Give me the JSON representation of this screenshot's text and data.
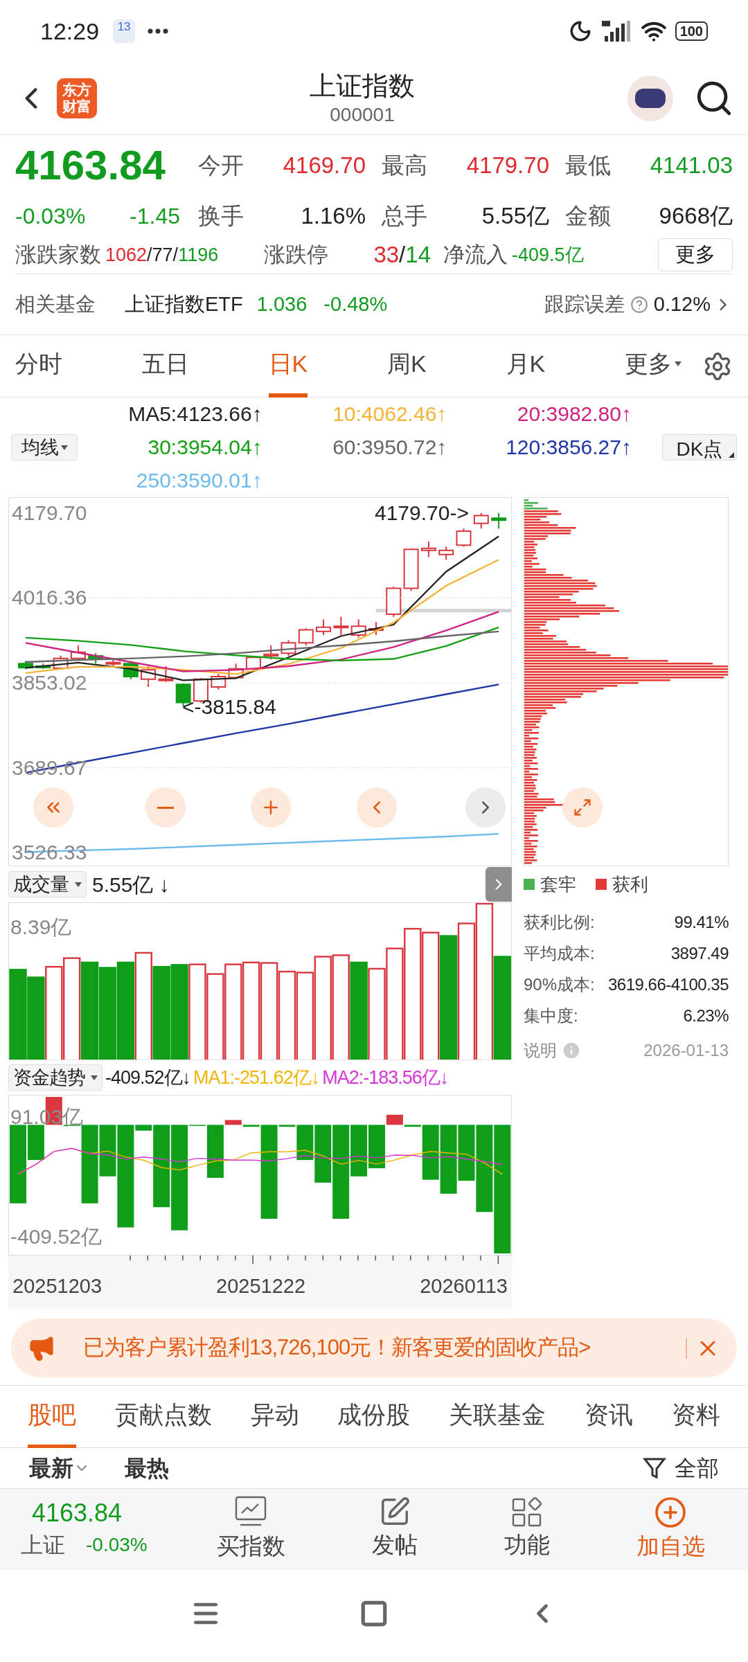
{
  "status_bar": {
    "time": "12:29",
    "date_badge": "13",
    "battery": "100"
  },
  "header": {
    "logo_lines": [
      "东方",
      "财富"
    ],
    "title": "上证指数",
    "code": "000001"
  },
  "quote": {
    "price": "4163.84",
    "change_pct": "-0.03%",
    "change": "-1.45",
    "color": "#119c1f",
    "stats": [
      {
        "label": "今开",
        "value": "4169.70",
        "color": "#e0282e"
      },
      {
        "label": "最高",
        "value": "4179.70",
        "color": "#e0282e"
      },
      {
        "label": "最低",
        "value": "4141.03",
        "color": "#119c1f"
      },
      {
        "label": "换手",
        "value": "1.16%",
        "color": "#222222"
      },
      {
        "label": "总手",
        "value": "5.55亿",
        "color": "#222222"
      },
      {
        "label": "金额",
        "value": "9668亿",
        "color": "#222222"
      }
    ],
    "breadth": [
      {
        "label": "涨跌家数",
        "parts": [
          {
            "text": "1062",
            "color": "#e0282e"
          },
          {
            "text": "/77/",
            "color": "#222222"
          },
          {
            "text": "1196",
            "color": "#119c1f"
          }
        ]
      },
      {
        "label": "涨跌停",
        "parts": [
          {
            "text": "33",
            "color": "#e0282e"
          },
          {
            "text": "/",
            "color": "#222222"
          },
          {
            "text": "14",
            "color": "#119c1f"
          }
        ]
      },
      {
        "label": "净流入",
        "parts": [
          {
            "text": "-409.5亿",
            "color": "#119c1f"
          }
        ]
      }
    ],
    "more_button": "更多"
  },
  "fund": {
    "label": "相关基金",
    "name": "上证指数ETF",
    "price": "1.036",
    "change": "-0.48%",
    "color": "#119c1f",
    "error_label": "跟踪误差",
    "error_value": "0.12%"
  },
  "tabs": [
    {
      "label": "分时",
      "selected": false,
      "dropdown": false
    },
    {
      "label": "五日",
      "selected": false,
      "dropdown": false
    },
    {
      "label": "日K",
      "selected": true,
      "dropdown": false
    },
    {
      "label": "周K",
      "selected": false,
      "dropdown": false
    },
    {
      "label": "月K",
      "selected": false,
      "dropdown": false
    },
    {
      "label": "更多",
      "selected": false,
      "dropdown": true
    }
  ],
  "ma_legend": {
    "selector": "均线",
    "dk_button": "DK点",
    "items": [
      {
        "text": "MA5:4123.66↑",
        "color": "#222222"
      },
      {
        "text": "10:4062.46↑",
        "color": "#f5b335"
      },
      {
        "text": "20:3982.80↑",
        "color": "#d0237f"
      },
      {
        "text": "30:3954.04↑",
        "color": "#14a014"
      },
      {
        "text": "60:3950.72↑",
        "color": "#666666"
      },
      {
        "text": "120:3856.27↑",
        "color": "#1f35a8"
      },
      {
        "text": "250:3590.01↑",
        "color": "#6bbbef"
      }
    ]
  },
  "chart": {
    "high_marker": "4179.70->",
    "low_marker": "<-3815.84",
    "chart_data": {
      "type": "line",
      "grid": true,
      "ylim": [
        3498.33,
        4209.03
      ],
      "yticks": [
        {
          "value": 4179.7,
          "label": "4179.70"
        },
        {
          "value": 4016.36,
          "label": "4016.36"
        },
        {
          "value": 3853.02,
          "label": "3853.02"
        },
        {
          "value": 3689.67,
          "label": "3689.67"
        },
        {
          "value": 3526.33,
          "label": "3526.33"
        }
      ],
      "series": [
        {
          "color": "#222222",
          "values": [
            3882,
            3892,
            3880,
            3858,
            3862,
            3902,
            3943,
            3965,
            4067,
            4135
          ]
        },
        {
          "color": "#f5b335",
          "values": [
            3872,
            3884,
            3884,
            3878,
            3870,
            3889,
            3920,
            3969,
            4040,
            4090
          ]
        },
        {
          "color": "#d0237f",
          "values": [
            3930,
            3911,
            3893,
            3875,
            3878,
            3885,
            3898,
            3922,
            3954,
            3990
          ]
        },
        {
          "color": "#14a014",
          "values": [
            3940,
            3934,
            3926,
            3914,
            3906,
            3899,
            3896,
            3899,
            3924,
            3960
          ]
        },
        {
          "color": "#666666",
          "values": [
            3893,
            3897,
            3900,
            3904,
            3910,
            3918,
            3925,
            3933,
            3943,
            3952
          ]
        },
        {
          "color": "#1f35a8",
          "values": [
            3680,
            3699,
            3718,
            3737,
            3756,
            3774,
            3793,
            3812,
            3831,
            3850
          ]
        },
        {
          "color": "#6bbbef",
          "values": [
            3527,
            3530,
            3533,
            3537,
            3541,
            3545,
            3549,
            3553,
            3557,
            3562
          ]
        }
      ]
    }
  },
  "chips": {
    "legend": [
      {
        "label": "套牢",
        "color": "#4caf50"
      },
      {
        "label": "获利",
        "color": "#e53935"
      }
    ],
    "stats": [
      {
        "label": "获利比例:",
        "value": "99.41%"
      },
      {
        "label": "平均成本:",
        "value": "3897.49"
      },
      {
        "label": "90%成本:",
        "value": "3619.66-4100.35"
      },
      {
        "label": "集中度:",
        "value": "6.23%"
      }
    ],
    "note": "说明",
    "date": "2026-01-13"
  },
  "volume": {
    "selector": "成交量",
    "value": "5.55亿 ↓",
    "y_label": "8.39亿"
  },
  "fund_flow": {
    "selector": "资金趋势",
    "values": [
      {
        "text": "-409.52亿↓",
        "color": "#222222"
      },
      {
        "text": "MA1:-251.62亿↓",
        "color": "#f0b400"
      },
      {
        "text": "MA2:-183.56亿↓",
        "color": "#d633d6"
      }
    ],
    "y_top": "91.03亿",
    "y_bottom": "-409.52亿"
  },
  "dates": [
    "20251203",
    "20251222",
    "20260113"
  ],
  "banner": {
    "text": "已为客户累计盈利13,726,100元！新客更爱的固收产品>"
  },
  "section_tabs": [
    {
      "label": "股吧",
      "selected": true
    },
    {
      "label": "贡献点数",
      "selected": false
    },
    {
      "label": "异动",
      "selected": false
    },
    {
      "label": "成份股",
      "selected": false
    },
    {
      "label": "关联基金",
      "selected": false
    },
    {
      "label": "资讯",
      "selected": false
    },
    {
      "label": "资料",
      "selected": false
    }
  ],
  "sort": {
    "options": [
      {
        "label": "最新",
        "dropdown": true
      },
      {
        "label": "最热",
        "dropdown": false
      }
    ],
    "filter": "全部"
  },
  "bottom_bar": {
    "index_price": "4163.84",
    "index_name": "上证",
    "index_change": "-0.03%",
    "color": "#119c1f",
    "actions": [
      {
        "label": "买指数",
        "accent": false
      },
      {
        "label": "发帖",
        "accent": false
      },
      {
        "label": "功能",
        "accent": false
      },
      {
        "label": "加自选",
        "accent": true
      }
    ]
  }
}
